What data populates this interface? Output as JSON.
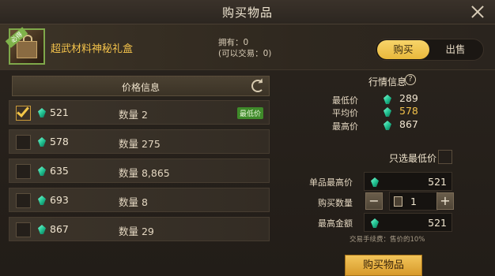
{
  "dialog": {
    "title": "购买物品"
  },
  "item": {
    "name": "超武材料神秘礼盒",
    "icon_tag": "必得",
    "owned_line1": "拥有：0",
    "owned_line2": "(可以交易：0)"
  },
  "tabs": {
    "buy": "购买",
    "sell": "出售",
    "selected": "buy"
  },
  "price_list": {
    "header": "价格信息",
    "rows": [
      {
        "price": "521",
        "qty_label": "数量 2",
        "badge": "最低价",
        "checked": true
      },
      {
        "price": "578",
        "qty_label": "数量 275",
        "badge": "",
        "checked": false
      },
      {
        "price": "635",
        "qty_label": "数量 8,865",
        "badge": "",
        "checked": false
      },
      {
        "price": "693",
        "qty_label": "数量 8",
        "badge": "",
        "checked": false
      },
      {
        "price": "867",
        "qty_label": "数量 29",
        "badge": "",
        "checked": false
      }
    ]
  },
  "market": {
    "title": "行情信息",
    "help": "?",
    "min_label": "最低价",
    "min_value": "289",
    "avg_label": "平均价",
    "avg_value": "578",
    "max_label": "最高价",
    "max_value": "867"
  },
  "order": {
    "only_lowest_label": "只选最低价",
    "only_lowest_checked": false,
    "unit_max_label": "单品最高价",
    "unit_max_value": "521",
    "qty_label": "购买数量",
    "qty_value": "1",
    "minus": "−",
    "plus": "+",
    "total_label": "最高金额",
    "total_value": "521",
    "fee_note": "交易手续费：售价的10%",
    "buy_button": "购买物品"
  },
  "colors": {
    "gold": "#f3c24b",
    "badge_green": "#3f8a2a",
    "gem": "#1fbf8f"
  }
}
